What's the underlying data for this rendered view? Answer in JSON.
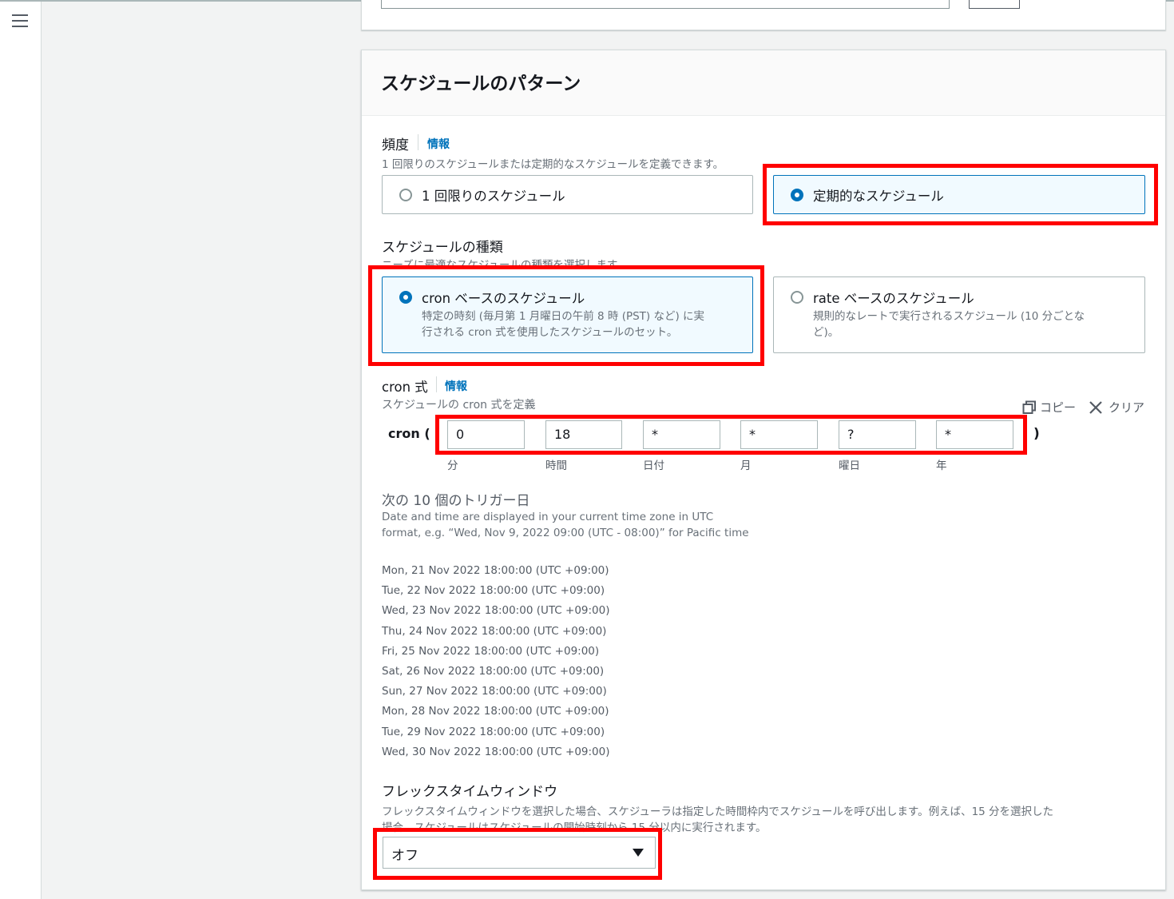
{
  "colors": {
    "accent": "#0073bb",
    "highlight": "#ff0000",
    "selected_bg": "#f1faff"
  },
  "nav": {
    "menu_icon": "hamburger-menu-icon"
  },
  "section": {
    "title": "スケジュールのパターン"
  },
  "frequency": {
    "label": "頻度",
    "info": "情報",
    "description": "1 回限りのスケジュールまたは定期的なスケジュールを定義できます。",
    "options": [
      {
        "label": "1 回限りのスケジュール",
        "selected": false
      },
      {
        "label": "定期的なスケジュール",
        "selected": true
      }
    ]
  },
  "schedule_type": {
    "label": "スケジュールの種類",
    "description": "ニーズに最適なスケジュールの種類を選択します。",
    "options": [
      {
        "label": "cron ベースのスケジュール",
        "description_line1": "特定の時刻 (毎月第 1 月曜日の午前 8 時 (PST) など) に実",
        "description_line2": "行される cron 式を使用したスケジュールのセット。",
        "selected": true
      },
      {
        "label": "rate ベースのスケジュール",
        "description_line1": "規則的なレートで実行されるスケジュール (10 分ごとな",
        "description_line2": "ど)。",
        "selected": false
      }
    ]
  },
  "cron": {
    "label": "cron 式",
    "info": "情報",
    "description": "スケジュールの cron 式を定義",
    "copy": "コピー",
    "clear": "クリア",
    "prefix": "cron (",
    "suffix": ")",
    "fields": [
      {
        "value": "0",
        "caption": "分"
      },
      {
        "value": "18",
        "caption": "時間"
      },
      {
        "value": "*",
        "caption": "日付"
      },
      {
        "value": "*",
        "caption": "月"
      },
      {
        "value": "?",
        "caption": "曜日"
      },
      {
        "value": "*",
        "caption": "年"
      }
    ]
  },
  "triggers": {
    "title": "次の 10 個のトリガー日",
    "note_line1": "Date and time are displayed in your current time zone in UTC",
    "note_line2": "format, e.g. “Wed, Nov 9, 2022 09:00 (UTC - 08:00)” for Pacific time",
    "dates": [
      "Mon, 21 Nov 2022 18:00:00 (UTC +09:00)",
      "Tue, 22 Nov 2022 18:00:00 (UTC +09:00)",
      "Wed, 23 Nov 2022 18:00:00 (UTC +09:00)",
      "Thu, 24 Nov 2022 18:00:00 (UTC +09:00)",
      "Fri, 25 Nov 2022 18:00:00 (UTC +09:00)",
      "Sat, 26 Nov 2022 18:00:00 (UTC +09:00)",
      "Sun, 27 Nov 2022 18:00:00 (UTC +09:00)",
      "Mon, 28 Nov 2022 18:00:00 (UTC +09:00)",
      "Tue, 29 Nov 2022 18:00:00 (UTC +09:00)",
      "Wed, 30 Nov 2022 18:00:00 (UTC +09:00)"
    ]
  },
  "flex": {
    "label": "フレックスタイムウィンドウ",
    "description_line1": "フレックスタイムウィンドウを選択した場合、スケジューラは指定した時間枠内でスケジュールを呼び出します。例えば、15 分を選択した",
    "description_line2": "場合、スケジュールはスケジュールの開始時刻から 15 分以内に実行されます。",
    "selected": "オフ"
  }
}
